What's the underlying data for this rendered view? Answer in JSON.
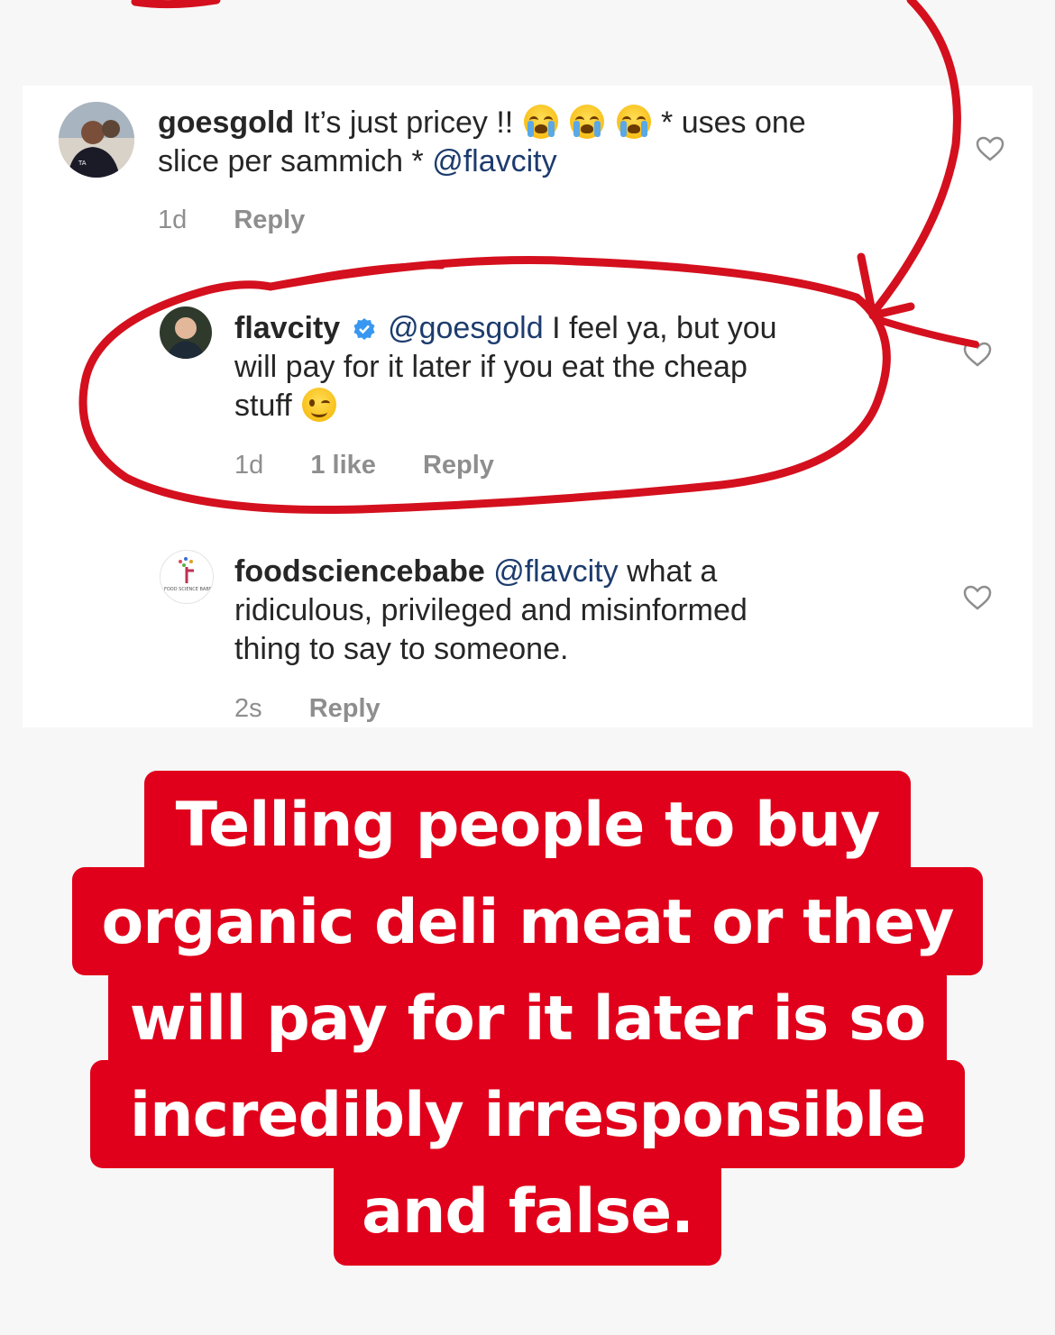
{
  "comments": [
    {
      "username": "goesgold",
      "text_a": "It’s just pricey !!",
      "text_b": "* uses one",
      "text_c": "slice per sammich *",
      "mention": "@flavcity",
      "time": "1d",
      "reply": "Reply"
    },
    {
      "username": "flavcity",
      "mention": "@goesgold",
      "text_a": "I feel ya, but you",
      "text_b": "will pay for it later if you eat the  cheap",
      "text_c": "stuff",
      "time": "1d",
      "likes": "1 like",
      "reply": "Reply"
    },
    {
      "username": "foodsciencebabe",
      "mention": "@flavcity",
      "text_a": "what a",
      "text_b": "ridiculous, privileged and misinformed",
      "text_c": "thing to say to someone.",
      "time": "2s",
      "reply": "Reply"
    }
  ],
  "banner": {
    "line1": "Telling people to buy",
    "line2": "organic deli meat or they",
    "line3": "will pay for it later is so",
    "line4": "incredibly irresponsible",
    "line5": "and false."
  },
  "avatar_badge": {
    "goesgold": "TA",
    "foodsciencebabe": "FOOD SCIENCE BABE"
  },
  "icons": {
    "emoji_cry": "loudly-crying-face-icon",
    "emoji_wink": "winking-face-icon",
    "verified": "verified-badge-icon",
    "heart": "heart-outline-icon"
  },
  "colors": {
    "banner_red": "#e0001b",
    "marker_red": "#d4101e",
    "verified_blue": "#3897f0",
    "meta_gray": "#8e8e8e"
  }
}
